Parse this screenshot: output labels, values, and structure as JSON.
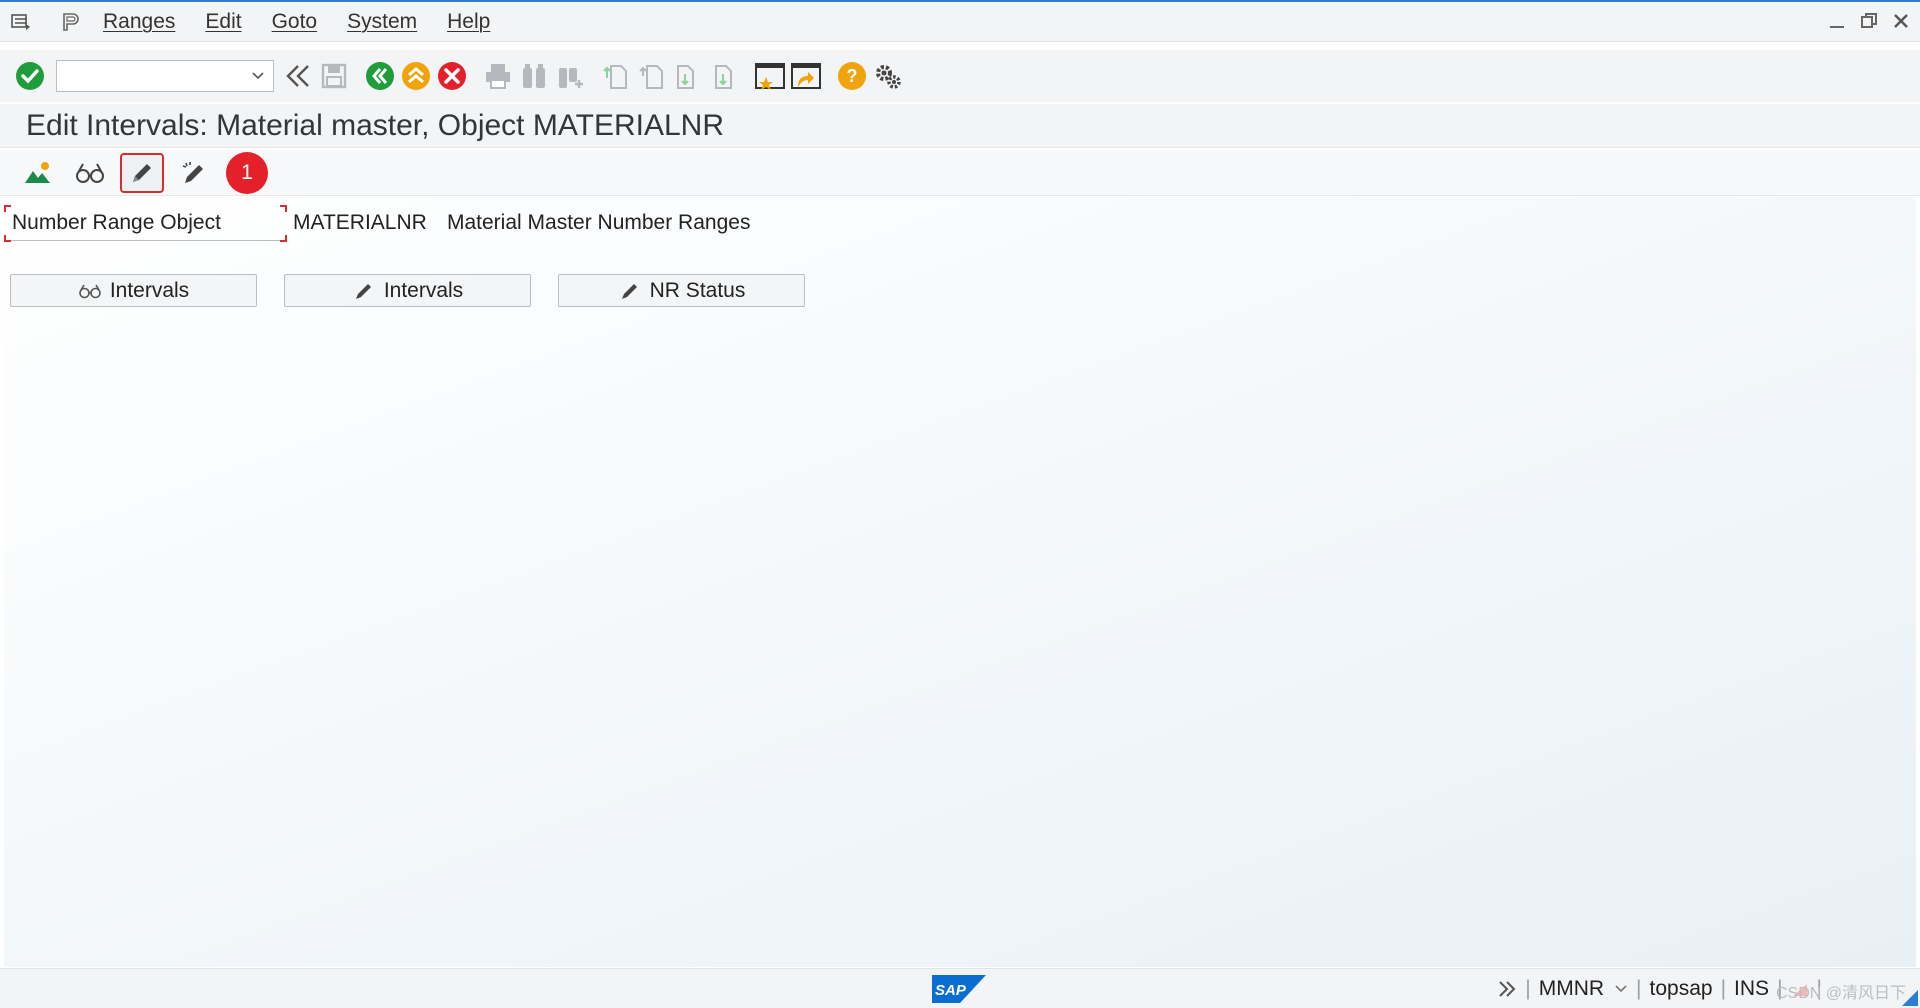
{
  "menu": {
    "items": [
      "Ranges",
      "Edit",
      "Goto",
      "System",
      "Help"
    ]
  },
  "toolbar": {
    "command_value": "",
    "icons": [
      "enter-icon",
      "back-double-chevron-icon",
      "save-icon",
      "back-icon",
      "exit-icon",
      "cancel-icon",
      "print-icon",
      "find-icon",
      "find-next-icon",
      "first-page-icon",
      "previous-page-icon",
      "next-page-icon",
      "last-page-icon",
      "create-session-icon",
      "create-shortcut-icon",
      "help-icon",
      "customize-layout-icon"
    ]
  },
  "title": "Edit Intervals: Material master, Object MATERIALNR",
  "app_toolbar": {
    "badge": "1",
    "icons": [
      "overview-icon",
      "display-intervals-icon",
      "change-intervals-icon",
      "change-status-icon"
    ]
  },
  "form": {
    "label": "Number Range Object",
    "object_value": "MATERIALNR",
    "object_description": "Material Master Number Ranges"
  },
  "buttons": {
    "display_intervals": "Intervals",
    "change_intervals": "Intervals",
    "nr_status": "NR Status"
  },
  "status": {
    "transaction": "MMNR",
    "system_user": "topsap",
    "mode": "INS",
    "watermark": "CSDN @清风日下"
  },
  "colors": {
    "accent": "#2a7fd4",
    "green": "#1f9d3a",
    "orange": "#f0a30a",
    "red": "#e4202a",
    "brand": "#0a6ed1"
  }
}
